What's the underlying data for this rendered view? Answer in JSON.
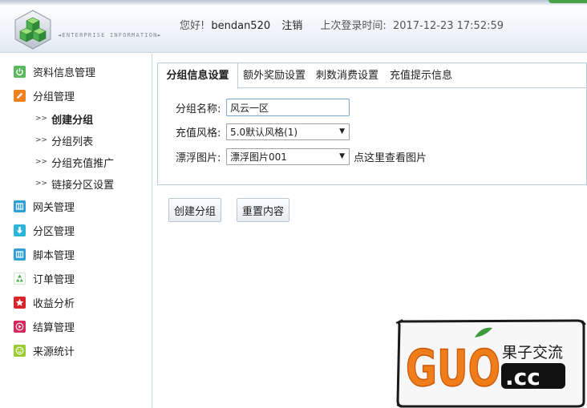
{
  "header": {
    "logo_caption": "◄ENTERPRISE INFORMATION►",
    "greeting": "您好!",
    "username": "bendan520",
    "logout_label": "注销",
    "last_login_label": "上次登录时间:",
    "last_login_value": "2017-12-23 17:52:59"
  },
  "sidebar": {
    "items": [
      {
        "label": "资料信息管理",
        "icon": "power-icon",
        "color": "#5cb85c"
      },
      {
        "label": "分组管理",
        "icon": "pencil-icon",
        "color": "#f0821e"
      },
      {
        "label": "网关管理",
        "icon": "grid-icon",
        "color": "#2e9fd8"
      },
      {
        "label": "分区管理",
        "icon": "download-icon",
        "color": "#2bb5d8"
      },
      {
        "label": "脚本管理",
        "icon": "grid-icon",
        "color": "#2e9fd8"
      },
      {
        "label": "订单管理",
        "icon": "recycle-icon",
        "color": "#4caf50"
      },
      {
        "label": "收益分析",
        "icon": "star-icon",
        "color": "#d9242a"
      },
      {
        "label": "结算管理",
        "icon": "play-icon",
        "color": "#d9285f"
      },
      {
        "label": "来源统计",
        "icon": "smiley-icon",
        "color": "#9acd32"
      }
    ],
    "sub_items": [
      {
        "label": "创建分组",
        "active": true
      },
      {
        "label": "分组列表",
        "active": false
      },
      {
        "label": "分组充值推广",
        "active": false
      },
      {
        "label": "链接分区设置",
        "active": false
      }
    ],
    "sub_arrow": ">>"
  },
  "tabs": [
    {
      "label": "分组信息设置",
      "active": true
    },
    {
      "label": "额外奖励设置",
      "active": false
    },
    {
      "label": "刺数消费设置",
      "active": false
    },
    {
      "label": "充值提示信息",
      "active": false
    }
  ],
  "form": {
    "name_label": "分组名称:",
    "name_value": "风云一区",
    "style_label": "充值风格:",
    "style_value": "5.0默认风格(1)",
    "image_label": "漂浮图片:",
    "image_value": "漂浮图片001",
    "view_image_link": "点这里查看图片"
  },
  "buttons": {
    "create": "创建分组",
    "reset": "重置内容"
  },
  "watermark": {
    "brand_big": "GUO",
    "brand_cn": "果子交流",
    "brand_domain": ".cc"
  }
}
